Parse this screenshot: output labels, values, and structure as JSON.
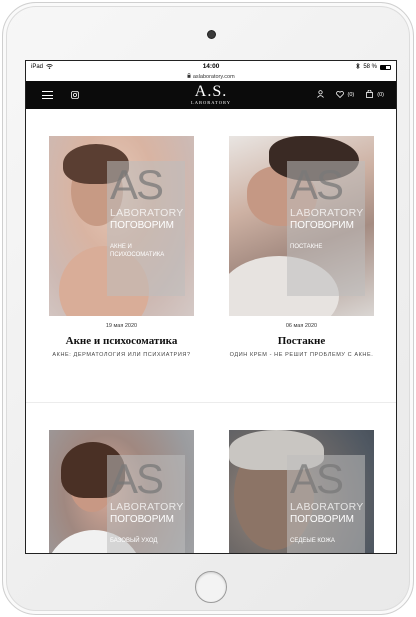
{
  "status_bar": {
    "device": "iPad",
    "time": "14:00",
    "battery": "58 %",
    "url": "aslaboratory.com"
  },
  "header": {
    "logo_main": "A.S.",
    "logo_sub": "LABORATORY",
    "favorites_count": "(0)",
    "cart_count": "(0)",
    "icons": [
      "menu-icon",
      "instagram-icon",
      "user-icon",
      "heart-icon",
      "bag-icon"
    ]
  },
  "cards": [
    {
      "overlay_brand": "AS",
      "overlay_lab": "LABORATORY",
      "overlay_talk": "ПОГОВОРИМ",
      "overlay_topic": "АКНЕ И ПСИХОСОМАТИКА",
      "date": "19 мая 2020",
      "title": "Акне и психосоматика",
      "subtitle": "АКНЕ: ДЕРМАТОЛОГИЯ ИЛИ ПСИХИАТРИЯ?"
    },
    {
      "overlay_brand": "AS",
      "overlay_lab": "LABORATORY",
      "overlay_talk": "ПОГОВОРИМ",
      "overlay_topic": "ПОСТАКНЕ",
      "date": "06 мая 2020",
      "title": "Постакне",
      "subtitle": "ОДИН КРЕМ - НЕ РЕШИТ ПРОБЛЕМУ С АКНЕ."
    },
    {
      "overlay_brand": "AS",
      "overlay_lab": "LABORATORY",
      "overlay_talk": "ПОГОВОРИМ",
      "overlay_topic": "БАЗОВЫЙ УХОД"
    },
    {
      "overlay_brand": "AS",
      "overlay_lab": "LABORATORY",
      "overlay_talk": "ПОГОВОРИМ",
      "overlay_topic": "СЕДЕЫЕ КОЖА"
    }
  ],
  "colors": {
    "header_bg": "#0b0b0b",
    "accent": "#ffffff"
  }
}
